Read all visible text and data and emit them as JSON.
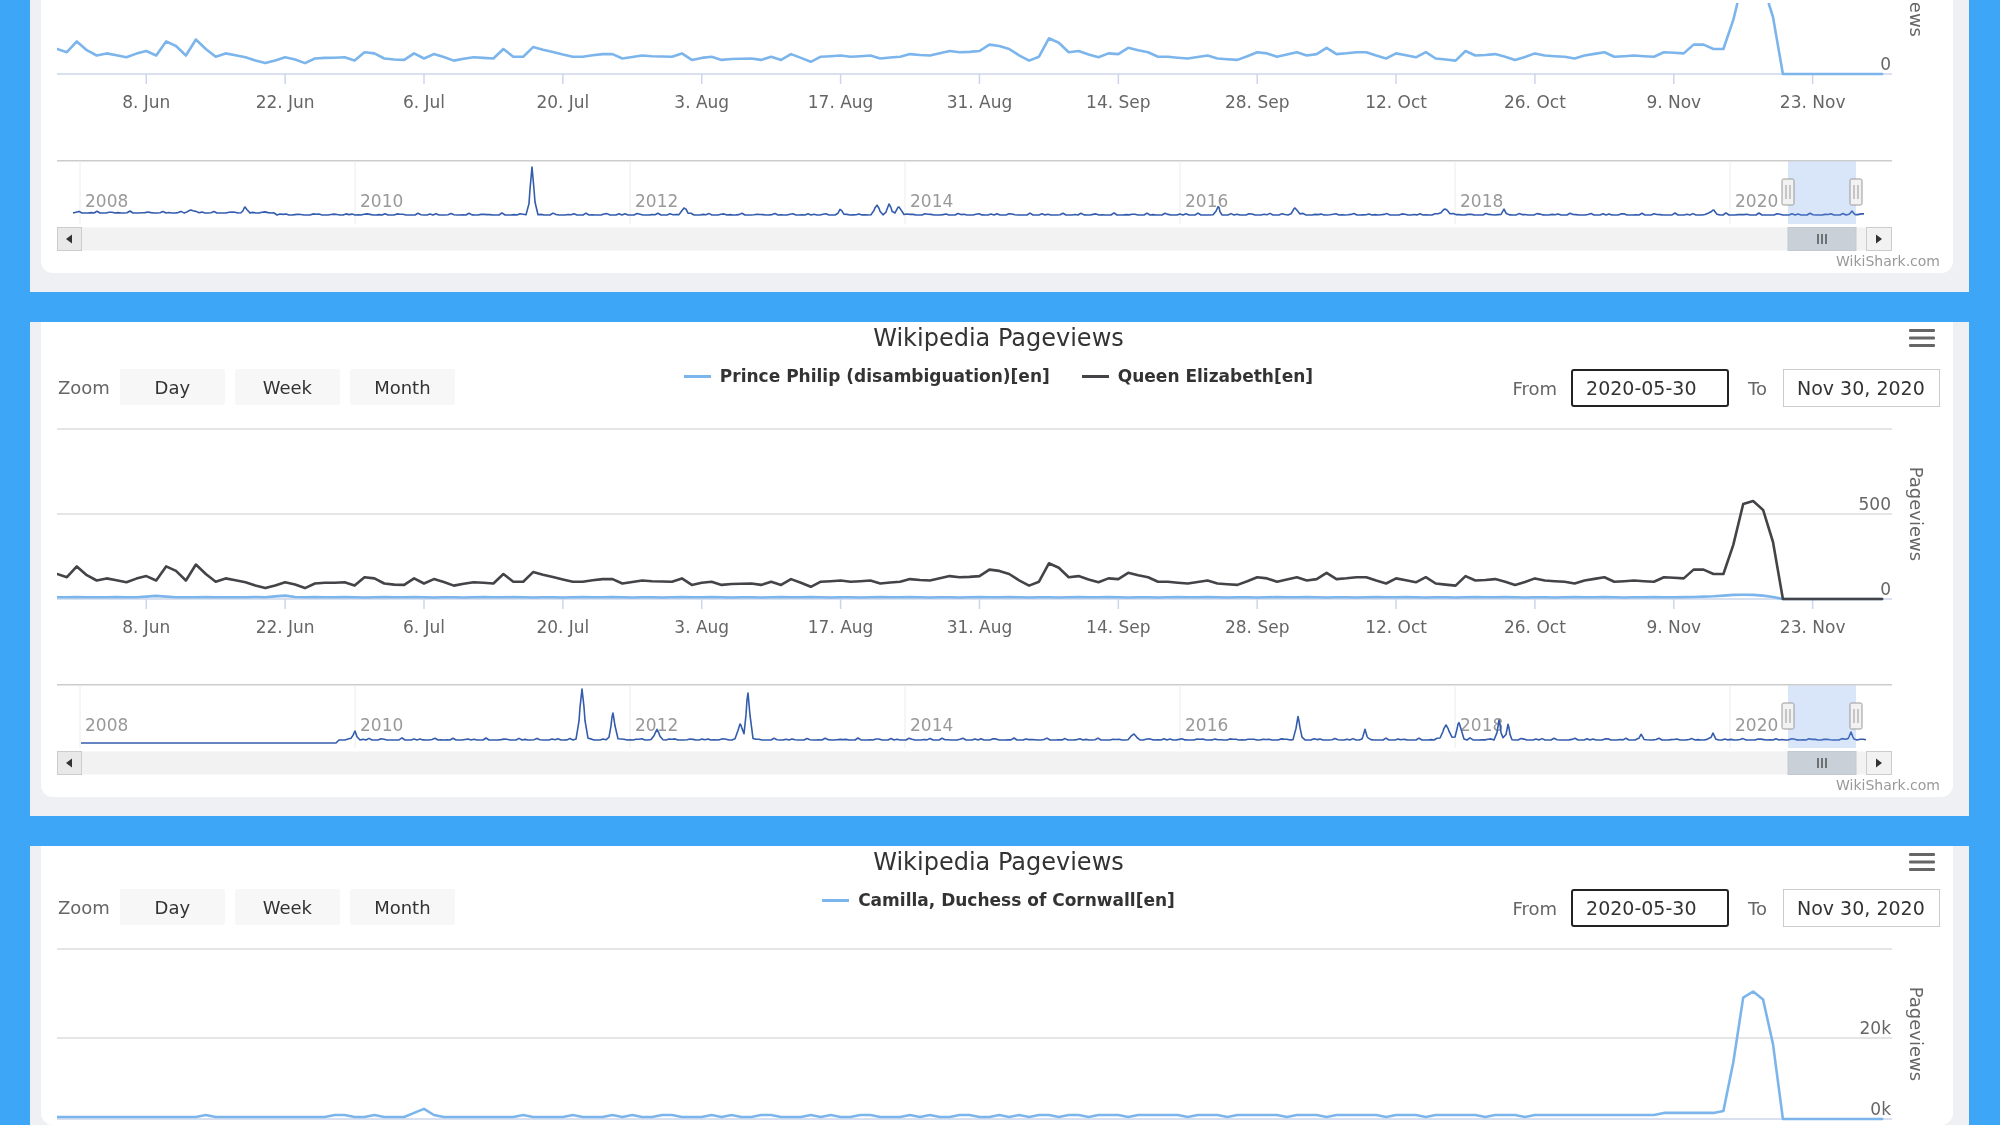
{
  "panels": [
    {
      "x_axis_labels": [
        "8. Jun",
        "22. Jun",
        "6. Jul",
        "20. Jul",
        "3. Aug",
        "17. Aug",
        "31. Aug",
        "14. Sep",
        "28. Sep",
        "12. Oct",
        "26. Oct",
        "9. Nov",
        "23. Nov"
      ],
      "y_axis_labels": [
        "0"
      ],
      "y_axis_title": "ews",
      "navigator_years": [
        "2008",
        "2010",
        "2012",
        "2014",
        "2016",
        "2018",
        "2020"
      ],
      "credit": "WikiShark.com"
    },
    {
      "title": "Wikipedia Pageviews",
      "zoom": {
        "label": "Zoom",
        "buttons": [
          {
            "label": "Day",
            "selected": false
          },
          {
            "label": "Week",
            "selected": false
          },
          {
            "label": "Month",
            "selected": false
          }
        ]
      },
      "date_range": {
        "from": {
          "label": "From",
          "value": "2020-05-30",
          "focused": true
        },
        "to": {
          "label": "To",
          "value": "Nov 30, 2020",
          "focused": false
        }
      },
      "chart_data": {
        "type": "line",
        "ylabel": "Pageviews",
        "categories": [
          null,
          null,
          null,
          null,
          null,
          null,
          null,
          null,
          null,
          "8. Jun",
          null,
          null,
          null,
          null,
          null,
          null,
          null,
          null,
          null,
          null,
          null,
          null,
          null,
          "22. Jun",
          null,
          null,
          null,
          null,
          null,
          null,
          null,
          null,
          null,
          null,
          null,
          null,
          null,
          "6. Jul",
          null,
          null,
          null,
          null,
          null,
          null,
          null,
          null,
          null,
          null,
          null,
          null,
          null,
          "20. Jul",
          null,
          null,
          null,
          null,
          null,
          null,
          null,
          null,
          null,
          null,
          null,
          null,
          null,
          "3. Aug",
          null,
          null,
          null,
          null,
          null,
          null,
          null,
          null,
          null,
          null,
          null,
          null,
          null,
          "17. Aug",
          null,
          null,
          null,
          null,
          null,
          null,
          null,
          null,
          null,
          null,
          null,
          null,
          null,
          "31. Aug",
          null,
          null,
          null,
          null,
          null,
          null,
          null,
          null,
          null,
          null,
          null,
          null,
          null,
          "14. Sep",
          null,
          null,
          null,
          null,
          null,
          null,
          null,
          null,
          null,
          null,
          null,
          null,
          null,
          "28. Sep",
          null,
          null,
          null,
          null,
          null,
          null,
          null,
          null,
          null,
          null,
          null,
          null,
          null,
          "12. Oct",
          null,
          null,
          null,
          null,
          null,
          null,
          null,
          null,
          null,
          null,
          null,
          null,
          null,
          "26. Oct",
          null,
          null,
          null,
          null,
          null,
          null,
          null,
          null,
          null,
          null,
          null,
          null,
          null,
          "9. Nov",
          null,
          null,
          null,
          null,
          null,
          null,
          null,
          null,
          null,
          null,
          null,
          null,
          null,
          "23. Nov",
          null,
          null,
          null,
          null,
          null,
          null,
          null
        ],
        "ylim": [
          0,
          1000
        ],
        "yticks": [
          0,
          500
        ],
        "series": [
          {
            "name": "Prince Philip (disambiguation)[en]",
            "color": "#7cb5ec",
            "values": [
              10,
              10,
              12,
              10,
              10,
              10,
              12,
              10,
              10,
              14,
              18,
              14,
              10,
              10,
              10,
              12,
              10,
              10,
              10,
              10,
              12,
              10,
              15,
              20,
              12,
              10,
              12,
              10,
              10,
              11,
              10,
              9,
              10,
              12,
              10,
              10,
              11,
              10,
              9,
              10,
              10,
              9,
              10,
              12,
              10,
              10,
              11,
              10,
              9,
              10,
              10,
              9,
              10,
              12,
              10,
              10,
              11,
              10,
              9,
              10,
              10,
              9,
              10,
              12,
              10,
              10,
              11,
              10,
              9,
              10,
              10,
              9,
              10,
              12,
              10,
              10,
              11,
              10,
              9,
              10,
              10,
              9,
              10,
              12,
              10,
              10,
              11,
              10,
              9,
              10,
              10,
              9,
              10,
              12,
              10,
              10,
              11,
              10,
              9,
              10,
              10,
              9,
              10,
              12,
              10,
              10,
              11,
              10,
              9,
              10,
              10,
              9,
              10,
              12,
              10,
              10,
              11,
              10,
              9,
              10,
              10,
              9,
              10,
              12,
              10,
              10,
              11,
              10,
              9,
              10,
              10,
              9,
              10,
              12,
              10,
              10,
              11,
              10,
              9,
              10,
              10,
              9,
              10,
              12,
              10,
              10,
              11,
              10,
              9,
              10,
              10,
              9,
              10,
              12,
              10,
              10,
              11,
              10,
              9,
              10,
              10,
              12,
              10,
              10,
              11,
              12,
              14,
              16,
              20,
              24,
              25,
              24,
              20,
              12,
              0,
              0,
              0,
              0,
              0,
              0,
              0,
              0,
              0,
              0,
              0
            ]
          },
          {
            "name": "Queen Elizabeth[en]",
            "color": "#434348",
            "values": [
              147,
              128,
              192,
              140,
              109,
              121,
              110,
              98,
              120,
              135,
              109,
              192,
              165,
              109,
              203,
              147,
              102,
              121,
              110,
              98,
              79,
              64,
              80,
              98,
              85,
              64,
              91,
              95,
              96,
              98,
              79,
              128,
              121,
              91,
              85,
              83,
              121,
              91,
              117,
              100,
              79,
              90,
              98,
              95,
              91,
              147,
              102,
              102,
              158,
              143,
              130,
              115,
              102,
              102,
              110,
              117,
              117,
              91,
              100,
              109,
              105,
              103,
              102,
              121,
              83,
              95,
              102,
              83,
              88,
              90,
              91,
              83,
              102,
              83,
              117,
              95,
              72,
              102,
              105,
              109,
              102,
              105,
              109,
              91,
              97,
              102,
              117,
              112,
              109,
              122,
              135,
              128,
              130,
              135,
              173,
              165,
              147,
              110,
              79,
              102,
              210,
              184,
              128,
              135,
              115,
              98,
              121,
              117,
              154,
              140,
              128,
              102,
              102,
              96,
              91,
              100,
              109,
              91,
              87,
              83,
              105,
              128,
              121,
              102,
              115,
              128,
              109,
              117,
              154,
              117,
              122,
              128,
              128,
              109,
              91,
              121,
              110,
              98,
              128,
              91,
              85,
              79,
              135,
              109,
              112,
              117,
              102,
              83,
              100,
              121,
              109,
              105,
              102,
              91,
              109,
              118,
              128,
              102,
              105,
              109,
              105,
              102,
              128,
              125,
              121,
              173,
              173,
              147,
              147,
              318,
              559,
              576,
              524,
              335,
              0,
              0,
              0,
              0,
              0,
              0,
              0,
              0,
              0,
              0,
              0
            ]
          }
        ]
      },
      "navigator_years": [
        "2008",
        "2010",
        "2012",
        "2014",
        "2016",
        "2018",
        "2020"
      ],
      "credit": "WikiShark.com"
    },
    {
      "title": "Wikipedia Pageviews",
      "zoom": {
        "label": "Zoom",
        "buttons": [
          {
            "label": "Day",
            "selected": false
          },
          {
            "label": "Week",
            "selected": false
          },
          {
            "label": "Month",
            "selected": false
          }
        ]
      },
      "date_range": {
        "from": {
          "label": "From",
          "value": "2020-05-30",
          "focused": true
        },
        "to": {
          "label": "To",
          "value": "Nov 30, 2020",
          "focused": false
        }
      },
      "chart_data": {
        "type": "line",
        "ylabel": "Pageviews",
        "categories": [
          null,
          null,
          null,
          null,
          null,
          null,
          null,
          null,
          null,
          null,
          null,
          null,
          null,
          null,
          null,
          null,
          null,
          null,
          null,
          null,
          null,
          null,
          null,
          null,
          null,
          null,
          null,
          null,
          null,
          null,
          null,
          null,
          null,
          null,
          null,
          null,
          null,
          null,
          null,
          null,
          null,
          null,
          null,
          null,
          null,
          null,
          null,
          null,
          null,
          null,
          null,
          null,
          null,
          null,
          null,
          null,
          null,
          null,
          null,
          null,
          null,
          null,
          null,
          null,
          null,
          null,
          null,
          null,
          null,
          null,
          null,
          null,
          null,
          null,
          null,
          null,
          null,
          null,
          null,
          null,
          null,
          null,
          null,
          null,
          null,
          null,
          null,
          null,
          null,
          null,
          null,
          null,
          null,
          null,
          null,
          null,
          null,
          null,
          null,
          null,
          null,
          null,
          null,
          null,
          null,
          null,
          null,
          null,
          null,
          null,
          null,
          null,
          null,
          null,
          null,
          null,
          null,
          null,
          null,
          null,
          null,
          null,
          null,
          null,
          null,
          null,
          null,
          null,
          null,
          null,
          null,
          null,
          null,
          null,
          null,
          null,
          null,
          null,
          null,
          null,
          null,
          null,
          null,
          null,
          null,
          null,
          null,
          null,
          null,
          null,
          null,
          null,
          null,
          null,
          null,
          null,
          null,
          null,
          null,
          null,
          null,
          null,
          null,
          null,
          null,
          null,
          null,
          null,
          null,
          null,
          null,
          null,
          null,
          null,
          null,
          null,
          null,
          null,
          null,
          null,
          null,
          null,
          null,
          null,
          null
        ],
        "ylim": [
          0,
          42000
        ],
        "yticks": [
          {
            "value": 0,
            "label": "0k"
          },
          {
            "value": 20000,
            "label": "20k"
          }
        ],
        "series": [
          {
            "name": "Camilla, Duchess of Cornwall[en]",
            "color": "#7cb5ec",
            "values": [
              500,
              500,
              500,
              500,
              500,
              500,
              500,
              500,
              500,
              500,
              500,
              500,
              500,
              500,
              500,
              1000,
              500,
              500,
              500,
              500,
              500,
              500,
              500,
              500,
              500,
              500,
              500,
              500,
              1000,
              1000,
              500,
              500,
              1000,
              500,
              500,
              500,
              1500,
              2500,
              1000,
              500,
              500,
              500,
              500,
              500,
              500,
              500,
              500,
              1000,
              500,
              500,
              500,
              500,
              1000,
              500,
              500,
              500,
              1000,
              500,
              1000,
              500,
              500,
              1000,
              1000,
              500,
              500,
              500,
              1000,
              500,
              1000,
              500,
              500,
              1000,
              1000,
              500,
              500,
              500,
              1000,
              500,
              1000,
              500,
              500,
              1000,
              1000,
              500,
              500,
              500,
              1000,
              500,
              1000,
              500,
              500,
              1000,
              1000,
              500,
              500,
              1000,
              500,
              1000,
              500,
              1000,
              1000,
              500,
              1000,
              1000,
              500,
              1000,
              1000,
              1000,
              500,
              1000,
              1000,
              1000,
              1000,
              1000,
              500,
              1000,
              1000,
              1000,
              500,
              1000,
              1000,
              1000,
              1000,
              1000,
              500,
              1000,
              1000,
              1000,
              500,
              1000,
              1000,
              1000,
              1000,
              1000,
              500,
              1000,
              1000,
              1000,
              500,
              1000,
              1000,
              1000,
              1000,
              1000,
              500,
              1000,
              1000,
              1000,
              500,
              1000,
              1000,
              1000,
              1000,
              1000,
              1000,
              1000,
              1000,
              1000,
              1000,
              1000,
              1000,
              1000,
              1500,
              1500,
              1500,
              1500,
              1500,
              1500,
              2000,
              14000,
              30000,
              31500,
              29500,
              18500,
              0,
              0,
              0,
              0,
              0,
              0,
              0,
              0,
              0,
              0,
              0
            ]
          }
        ]
      }
    }
  ]
}
